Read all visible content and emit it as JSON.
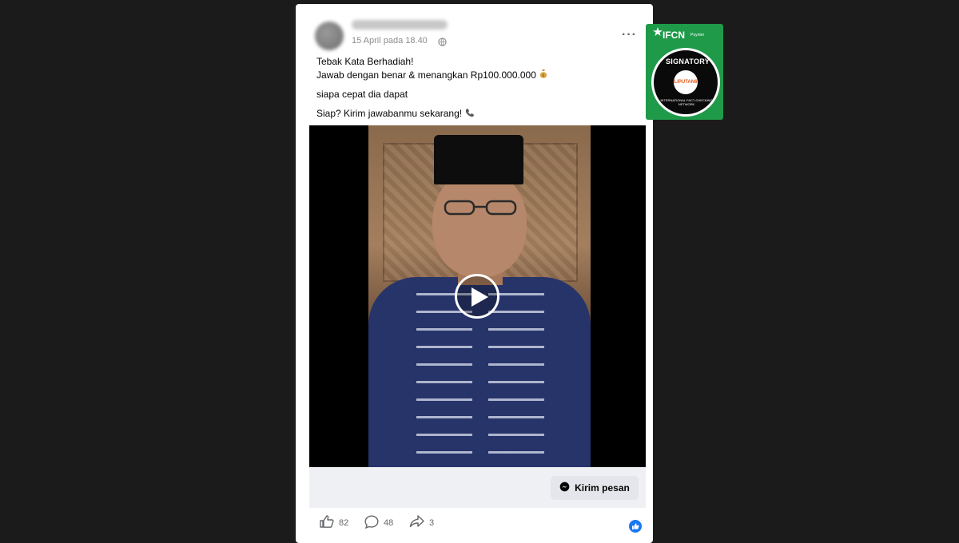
{
  "post": {
    "timestamp": "15 April pada 18.40",
    "more_label": "···",
    "caption": {
      "line1": "Tebak Kata Berhadiah!",
      "line2": "Jawab dengan benar & menangkan Rp100.000.000",
      "line3": "siapa cepat dia dapat",
      "line4": "Siap? Kirim jawabanmu sekarang!"
    },
    "message_button_label": "Kirim pesan",
    "likes_count": "82",
    "comments_count": "48",
    "shares_count": "3"
  },
  "badge": {
    "title": "IFCN",
    "subtitle": "Poynter",
    "signatory": "SIGNATORY",
    "network": "INTERNATIONAL FACT-CHECKING NETWORK",
    "member": "LIPUTAN6"
  },
  "icons": [
    "globe-icon",
    "more-icon",
    "money-bag-icon",
    "phone-icon",
    "play-icon",
    "messenger-icon",
    "like-icon",
    "comment-icon",
    "share-icon",
    "reaction-like-icon"
  ],
  "colors": {
    "background": "#1b1b1b",
    "card": "#ffffff",
    "badge": "#1f9a49",
    "reaction": "#1877f2"
  }
}
